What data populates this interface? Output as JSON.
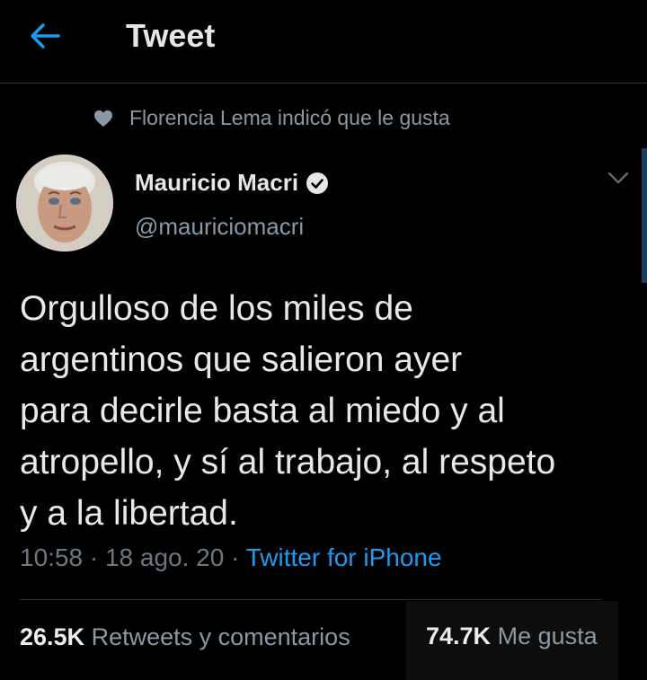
{
  "header": {
    "title": "Tweet",
    "back_icon": "arrow-left-icon",
    "accent_color": "#1d9bf0"
  },
  "social_context": {
    "text": "Florencia Lema indicó que le gusta",
    "icon": "heart-icon"
  },
  "author": {
    "name": "Mauricio Macri",
    "handle": "@mauriciomacri",
    "verified": true
  },
  "tweet": {
    "lines": [
      "Orgulloso de los miles de",
      "argentinos que salieron ayer",
      "para decirle basta al miedo y al",
      "atropello, y sí al trabajo, al respeto",
      "y a la libertad."
    ]
  },
  "meta": {
    "time": "10:58",
    "date": "18 ago. 20",
    "separator": "·",
    "source": "Twitter for iPhone"
  },
  "stats": {
    "retweets_count": "26.5K",
    "retweets_label": "Retweets y comentarios",
    "likes_count": "74.7K",
    "likes_label": "Me gusta"
  }
}
